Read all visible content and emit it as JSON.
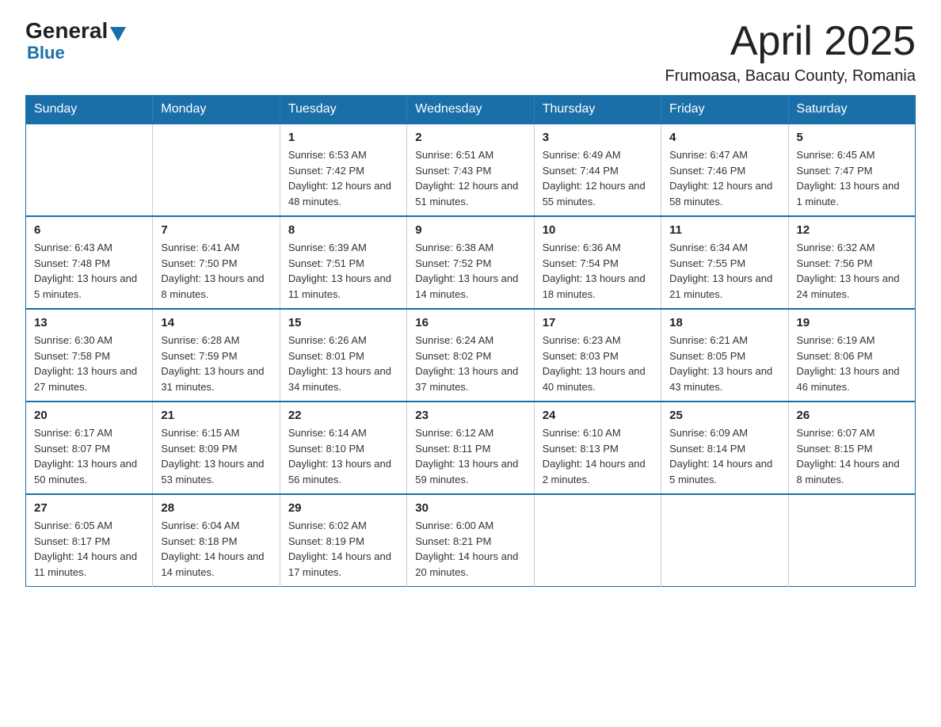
{
  "header": {
    "logo_general": "General",
    "logo_blue": "Blue",
    "month_year": "April 2025",
    "location": "Frumoasa, Bacau County, Romania"
  },
  "calendar": {
    "days_of_week": [
      "Sunday",
      "Monday",
      "Tuesday",
      "Wednesday",
      "Thursday",
      "Friday",
      "Saturday"
    ],
    "weeks": [
      [
        {
          "day": "",
          "sunrise": "",
          "sunset": "",
          "daylight": ""
        },
        {
          "day": "",
          "sunrise": "",
          "sunset": "",
          "daylight": ""
        },
        {
          "day": "1",
          "sunrise": "Sunrise: 6:53 AM",
          "sunset": "Sunset: 7:42 PM",
          "daylight": "Daylight: 12 hours and 48 minutes."
        },
        {
          "day": "2",
          "sunrise": "Sunrise: 6:51 AM",
          "sunset": "Sunset: 7:43 PM",
          "daylight": "Daylight: 12 hours and 51 minutes."
        },
        {
          "day": "3",
          "sunrise": "Sunrise: 6:49 AM",
          "sunset": "Sunset: 7:44 PM",
          "daylight": "Daylight: 12 hours and 55 minutes."
        },
        {
          "day": "4",
          "sunrise": "Sunrise: 6:47 AM",
          "sunset": "Sunset: 7:46 PM",
          "daylight": "Daylight: 12 hours and 58 minutes."
        },
        {
          "day": "5",
          "sunrise": "Sunrise: 6:45 AM",
          "sunset": "Sunset: 7:47 PM",
          "daylight": "Daylight: 13 hours and 1 minute."
        }
      ],
      [
        {
          "day": "6",
          "sunrise": "Sunrise: 6:43 AM",
          "sunset": "Sunset: 7:48 PM",
          "daylight": "Daylight: 13 hours and 5 minutes."
        },
        {
          "day": "7",
          "sunrise": "Sunrise: 6:41 AM",
          "sunset": "Sunset: 7:50 PM",
          "daylight": "Daylight: 13 hours and 8 minutes."
        },
        {
          "day": "8",
          "sunrise": "Sunrise: 6:39 AM",
          "sunset": "Sunset: 7:51 PM",
          "daylight": "Daylight: 13 hours and 11 minutes."
        },
        {
          "day": "9",
          "sunrise": "Sunrise: 6:38 AM",
          "sunset": "Sunset: 7:52 PM",
          "daylight": "Daylight: 13 hours and 14 minutes."
        },
        {
          "day": "10",
          "sunrise": "Sunrise: 6:36 AM",
          "sunset": "Sunset: 7:54 PM",
          "daylight": "Daylight: 13 hours and 18 minutes."
        },
        {
          "day": "11",
          "sunrise": "Sunrise: 6:34 AM",
          "sunset": "Sunset: 7:55 PM",
          "daylight": "Daylight: 13 hours and 21 minutes."
        },
        {
          "day": "12",
          "sunrise": "Sunrise: 6:32 AM",
          "sunset": "Sunset: 7:56 PM",
          "daylight": "Daylight: 13 hours and 24 minutes."
        }
      ],
      [
        {
          "day": "13",
          "sunrise": "Sunrise: 6:30 AM",
          "sunset": "Sunset: 7:58 PM",
          "daylight": "Daylight: 13 hours and 27 minutes."
        },
        {
          "day": "14",
          "sunrise": "Sunrise: 6:28 AM",
          "sunset": "Sunset: 7:59 PM",
          "daylight": "Daylight: 13 hours and 31 minutes."
        },
        {
          "day": "15",
          "sunrise": "Sunrise: 6:26 AM",
          "sunset": "Sunset: 8:01 PM",
          "daylight": "Daylight: 13 hours and 34 minutes."
        },
        {
          "day": "16",
          "sunrise": "Sunrise: 6:24 AM",
          "sunset": "Sunset: 8:02 PM",
          "daylight": "Daylight: 13 hours and 37 minutes."
        },
        {
          "day": "17",
          "sunrise": "Sunrise: 6:23 AM",
          "sunset": "Sunset: 8:03 PM",
          "daylight": "Daylight: 13 hours and 40 minutes."
        },
        {
          "day": "18",
          "sunrise": "Sunrise: 6:21 AM",
          "sunset": "Sunset: 8:05 PM",
          "daylight": "Daylight: 13 hours and 43 minutes."
        },
        {
          "day": "19",
          "sunrise": "Sunrise: 6:19 AM",
          "sunset": "Sunset: 8:06 PM",
          "daylight": "Daylight: 13 hours and 46 minutes."
        }
      ],
      [
        {
          "day": "20",
          "sunrise": "Sunrise: 6:17 AM",
          "sunset": "Sunset: 8:07 PM",
          "daylight": "Daylight: 13 hours and 50 minutes."
        },
        {
          "day": "21",
          "sunrise": "Sunrise: 6:15 AM",
          "sunset": "Sunset: 8:09 PM",
          "daylight": "Daylight: 13 hours and 53 minutes."
        },
        {
          "day": "22",
          "sunrise": "Sunrise: 6:14 AM",
          "sunset": "Sunset: 8:10 PM",
          "daylight": "Daylight: 13 hours and 56 minutes."
        },
        {
          "day": "23",
          "sunrise": "Sunrise: 6:12 AM",
          "sunset": "Sunset: 8:11 PM",
          "daylight": "Daylight: 13 hours and 59 minutes."
        },
        {
          "day": "24",
          "sunrise": "Sunrise: 6:10 AM",
          "sunset": "Sunset: 8:13 PM",
          "daylight": "Daylight: 14 hours and 2 minutes."
        },
        {
          "day": "25",
          "sunrise": "Sunrise: 6:09 AM",
          "sunset": "Sunset: 8:14 PM",
          "daylight": "Daylight: 14 hours and 5 minutes."
        },
        {
          "day": "26",
          "sunrise": "Sunrise: 6:07 AM",
          "sunset": "Sunset: 8:15 PM",
          "daylight": "Daylight: 14 hours and 8 minutes."
        }
      ],
      [
        {
          "day": "27",
          "sunrise": "Sunrise: 6:05 AM",
          "sunset": "Sunset: 8:17 PM",
          "daylight": "Daylight: 14 hours and 11 minutes."
        },
        {
          "day": "28",
          "sunrise": "Sunrise: 6:04 AM",
          "sunset": "Sunset: 8:18 PM",
          "daylight": "Daylight: 14 hours and 14 minutes."
        },
        {
          "day": "29",
          "sunrise": "Sunrise: 6:02 AM",
          "sunset": "Sunset: 8:19 PM",
          "daylight": "Daylight: 14 hours and 17 minutes."
        },
        {
          "day": "30",
          "sunrise": "Sunrise: 6:00 AM",
          "sunset": "Sunset: 8:21 PM",
          "daylight": "Daylight: 14 hours and 20 minutes."
        },
        {
          "day": "",
          "sunrise": "",
          "sunset": "",
          "daylight": ""
        },
        {
          "day": "",
          "sunrise": "",
          "sunset": "",
          "daylight": ""
        },
        {
          "day": "",
          "sunrise": "",
          "sunset": "",
          "daylight": ""
        }
      ]
    ]
  }
}
